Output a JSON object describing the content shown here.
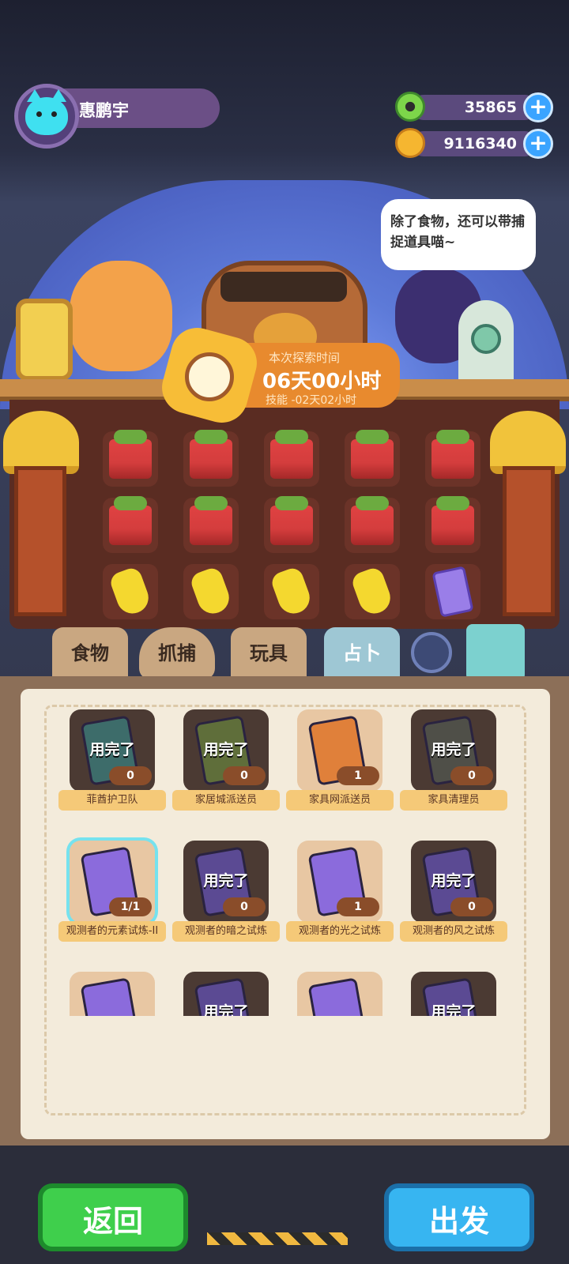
{
  "player": {
    "name": "惠鹏宇"
  },
  "currencies": [
    {
      "icon": "green-donut-coin-icon",
      "value": "35865"
    },
    {
      "icon": "gold-planet-coin-icon",
      "value": "9116340"
    }
  ],
  "speech_bubble": "除了食物，还可以带捕捉道具喵~",
  "explore": {
    "label": "本次探索时间",
    "time": "06天00小时",
    "skill": "技能 -02天02小时"
  },
  "tabs": [
    {
      "label": "食物",
      "active": false
    },
    {
      "label": "抓捕",
      "active": false
    },
    {
      "label": "玩具",
      "active": false
    },
    {
      "label": "占卜",
      "active": true
    }
  ],
  "cards": [
    {
      "name": "菲酋护卫队",
      "status": "用完了",
      "count": "0",
      "color": "#3d6c6a"
    },
    {
      "name": "家居城派送员",
      "status": "用完了",
      "count": "0",
      "color": "#5f6e3a"
    },
    {
      "name": "家具网派送员",
      "status": "",
      "count": "1",
      "color": "#e0803a"
    },
    {
      "name": "家具清理员",
      "status": "用完了",
      "count": "0",
      "color": "#4f4f48"
    },
    {
      "name": "观测者的元素试炼-II",
      "status": "",
      "count": "1/1",
      "color": "#8b6bdc"
    },
    {
      "name": "观测者的暗之试炼",
      "status": "用完了",
      "count": "0",
      "color": "#5b4a93"
    },
    {
      "name": "观测者的光之试炼",
      "status": "",
      "count": "1",
      "color": "#8b6bdc"
    },
    {
      "name": "观测者的风之试炼",
      "status": "用完了",
      "count": "0",
      "color": "#5b4a93"
    },
    {
      "name": "",
      "status": "",
      "count": "",
      "color": "#8b6bdc"
    },
    {
      "name": "",
      "status": "用完了",
      "count": "",
      "color": "#5b4a93"
    },
    {
      "name": "",
      "status": "",
      "count": "",
      "color": "#8b6bdc"
    },
    {
      "name": "",
      "status": "用完了",
      "count": "",
      "color": "#5b4a93"
    }
  ],
  "buttons": {
    "back": "返回",
    "go": "出发"
  }
}
